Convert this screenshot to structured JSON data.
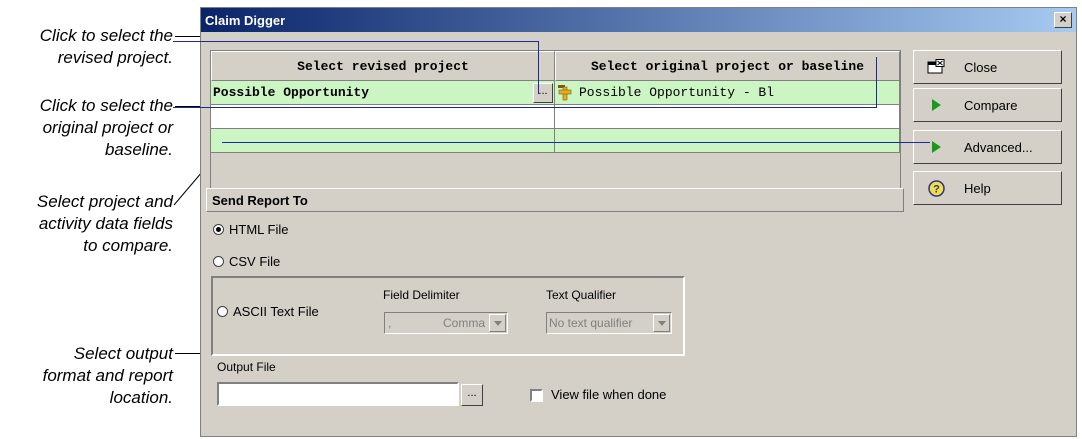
{
  "callouts": {
    "revised": [
      "Click to select the",
      "revised project."
    ],
    "original": [
      "Click to select the",
      "original project or",
      "baseline."
    ],
    "fields": [
      "Select project and",
      "activity data fields",
      "to compare."
    ],
    "output": [
      "Select output",
      "format and report",
      "location."
    ]
  },
  "window": {
    "title": "Claim Digger",
    "close_glyph": "×"
  },
  "grid": {
    "headers": [
      "Select revised project",
      "Select original project or baseline"
    ],
    "rows": [
      {
        "revised": "Possible Opportunity",
        "ellipsis": "...",
        "original": "Possible Opportunity - Bl"
      },
      {
        "revised": "",
        "original": ""
      },
      {
        "revised": "",
        "original": ""
      }
    ],
    "row_color": "#ccf5c4"
  },
  "buttons": {
    "close": "Close",
    "compare": "Compare",
    "advanced": "Advanced...",
    "help": "Help"
  },
  "report": {
    "heading": "Send Report To",
    "html_option": "HTML File",
    "csv_option": "CSV File",
    "ascii_option": "ASCII Text File",
    "selected": "HTML File",
    "field_delimiter_label": "Field Delimiter",
    "field_delimiter_value": ",",
    "field_delimiter_name": "Comma",
    "text_qualifier_label": "Text Qualifier",
    "text_qualifier_value": "No text qualifier",
    "output_file_label": "Output File",
    "output_file_value": "",
    "browse": "...",
    "view_when_done": "View file when done",
    "view_when_done_checked": false
  }
}
